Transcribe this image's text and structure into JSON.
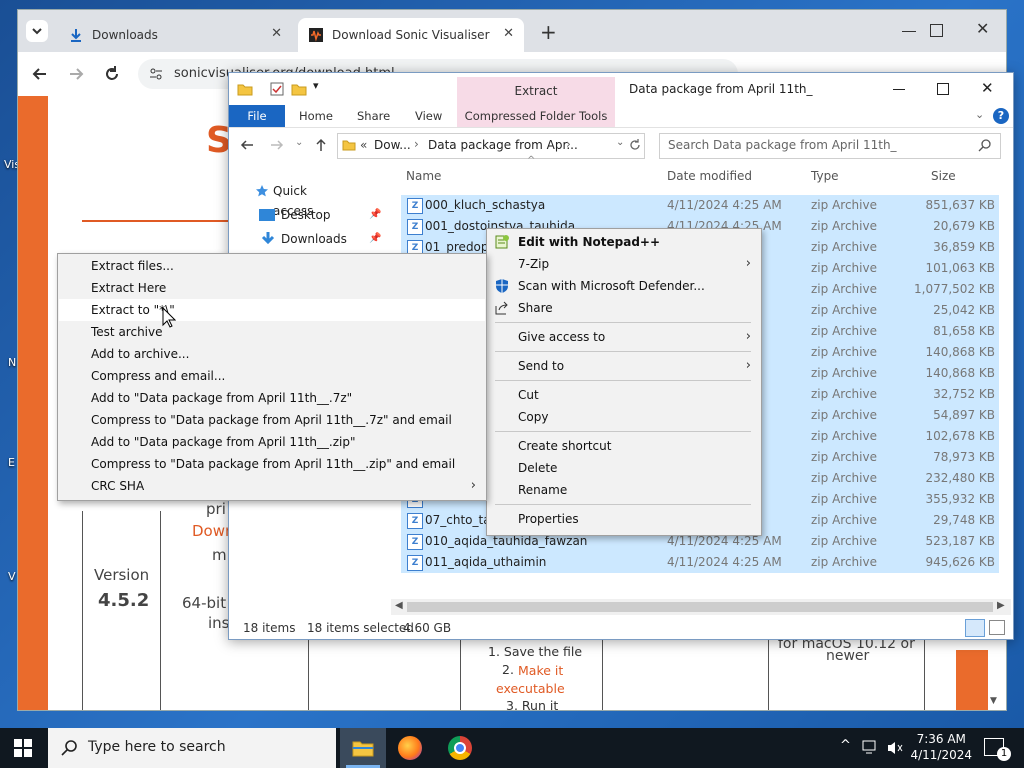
{
  "desktop": {
    "labels": [
      "Vis",
      "N",
      "E",
      "V"
    ]
  },
  "browser": {
    "tabs": [
      {
        "label": "Downloads",
        "close": "✕"
      },
      {
        "label": "Download Sonic Visualiser",
        "close": "✕"
      }
    ],
    "new_tab": "+",
    "url": "sonicvisualiser.org/download.html",
    "site": {
      "version_label": "Version",
      "version_value": "4.5.2",
      "frag_pri": "pri",
      "frag_down": "Down",
      "frag_m": "m",
      "frag_64bit": "64-bit",
      "frag_ins": "ins",
      "steps": {
        "step1": "1. Save the file",
        "step2_num": "2. ",
        "step2": "Make it executable",
        "step3": "3. Run it"
      },
      "frag_newer": "newer",
      "frag_top": "for macOS 10.12 or"
    }
  },
  "explorer": {
    "title": "Data package from April 11th_",
    "context_tab": "Extract",
    "ribbon_tabs": [
      "File",
      "Home",
      "Share",
      "View",
      "Compressed Folder Tools"
    ],
    "address": {
      "crumb1": "Dow...",
      "crumb2": "Data package from Apr...",
      "prefix": "«"
    },
    "search_placeholder": "Search Data package from April 11th_",
    "nav": [
      {
        "label": "Quick access"
      },
      {
        "label": "Desktop"
      },
      {
        "label": "Downloads"
      }
    ],
    "columns": [
      "Name",
      "Date modified",
      "Type",
      "Size"
    ],
    "files": [
      {
        "name": "000_kluch_schastya",
        "date": "4/11/2024 4:25 AM",
        "type": "zip Archive",
        "size": "851,637 KB"
      },
      {
        "name": "001_dostoinstva_tauhida",
        "date": "4/11/2024 4:25 AM",
        "type": "zip Archive",
        "size": "20,679 KB"
      },
      {
        "name": "01_predopr",
        "date": "",
        "type": "zip Archive",
        "size": "36,859 KB"
      },
      {
        "name": "",
        "date": "",
        "type": "zip Archive",
        "size": "101,063 KB"
      },
      {
        "name": "",
        "date": "",
        "type": "zip Archive",
        "size": "1,077,502 KB"
      },
      {
        "name": "",
        "date": "",
        "type": "zip Archive",
        "size": "25,042 KB"
      },
      {
        "name": "",
        "date": "",
        "type": "zip Archive",
        "size": "81,658 KB"
      },
      {
        "name": "",
        "date": "",
        "type": "zip Archive",
        "size": "140,868 KB"
      },
      {
        "name": "",
        "date": "",
        "type": "zip Archive",
        "size": "140,868 KB"
      },
      {
        "name": "",
        "date": "",
        "type": "zip Archive",
        "size": "32,752 KB"
      },
      {
        "name": "",
        "date": "",
        "type": "zip Archive",
        "size": "54,897 KB"
      },
      {
        "name": "",
        "date": "",
        "type": "zip Archive",
        "size": "102,678 KB"
      },
      {
        "name": "",
        "date": "",
        "type": "zip Archive",
        "size": "78,973 KB"
      },
      {
        "name": "",
        "date": "",
        "type": "zip Archive",
        "size": "232,480 KB"
      },
      {
        "name": "",
        "date": "",
        "type": "zip Archive",
        "size": "355,932 KB"
      },
      {
        "name": "07_chto_ta",
        "date": "",
        "type": "zip Archive",
        "size": "29,748 KB"
      },
      {
        "name": "010_aqida_tauhida_fawzan",
        "date": "4/11/2024 4:25 AM",
        "type": "zip Archive",
        "size": "523,187 KB"
      },
      {
        "name": "011_aqida_uthaimin",
        "date": "4/11/2024 4:25 AM",
        "type": "zip Archive",
        "size": "945,626 KB"
      }
    ],
    "status": {
      "items": "18 items",
      "selected": "18 items selected",
      "size": "4.60 GB"
    }
  },
  "context_menu": {
    "items": [
      {
        "label": "Edit with Notepad++",
        "bold": true
      },
      {
        "label": "7-Zip",
        "submenu": true
      },
      {
        "label": "Scan with Microsoft Defender..."
      },
      {
        "label": "Share"
      },
      {
        "label": "Give access to",
        "submenu": true
      },
      {
        "label": "Send to",
        "submenu": true
      },
      {
        "label": "Cut"
      },
      {
        "label": "Copy"
      },
      {
        "label": "Create shortcut"
      },
      {
        "label": "Delete"
      },
      {
        "label": "Rename"
      },
      {
        "label": "Properties"
      }
    ]
  },
  "sevenzip_menu": {
    "items": [
      {
        "label": "Extract files..."
      },
      {
        "label": "Extract Here"
      },
      {
        "label": "Extract to \"*\\\""
      },
      {
        "label": "Test archive"
      },
      {
        "label": "Add to archive..."
      },
      {
        "label": "Compress and email..."
      },
      {
        "label": "Add to \"Data package from April 11th__.7z\""
      },
      {
        "label": "Compress to \"Data package from April 11th__.7z\" and email"
      },
      {
        "label": "Add to \"Data package from April 11th__.zip\""
      },
      {
        "label": "Compress to \"Data package from April 11th__.zip\" and email"
      },
      {
        "label": "CRC SHA",
        "submenu": true
      }
    ]
  },
  "taskbar": {
    "search_placeholder": "Type here to search",
    "time": "7:36 AM",
    "date": "4/11/2024",
    "notification_count": "1"
  },
  "colors": {
    "selection": "#cce8ff",
    "accent": "#1a66c2",
    "orange": "#ea6b2c"
  }
}
